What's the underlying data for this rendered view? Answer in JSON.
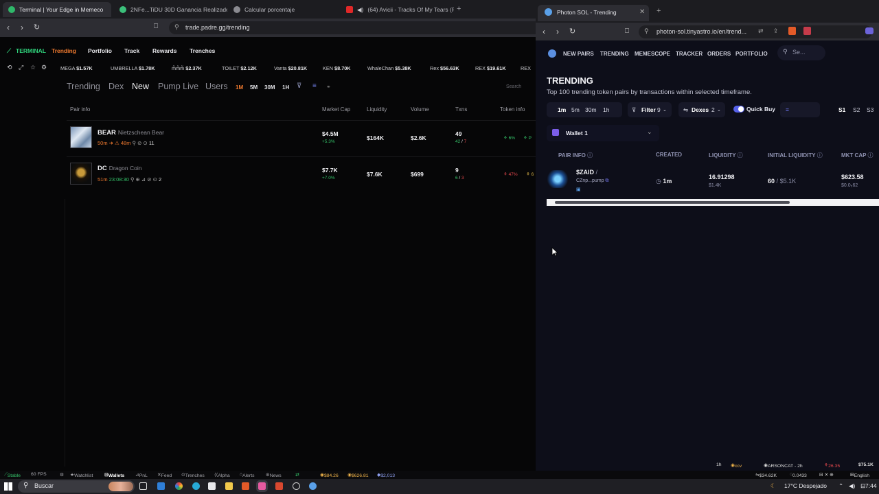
{
  "left_browser": {
    "tabs": [
      {
        "title": "Terminal | Your Edge in Memeco"
      },
      {
        "title": "2NFe...TiDU 30D Ganancia Realizado"
      },
      {
        "title": "Calcular porcentaje"
      },
      {
        "title": "(64) Avicii - Tracks Of My Tears (F"
      }
    ],
    "url": "trade.padre.gg/trending",
    "nav": {
      "logo": "TERMINAL",
      "items": [
        "Trending",
        "Portfolio",
        "Track",
        "Rewards",
        "Trenches"
      ]
    },
    "ticker": [
      {
        "name": "MEGA",
        "value": "$1.57K"
      },
      {
        "name": "UMBRELLA",
        "value": "$1.78K"
      },
      {
        "name": "m̃m̃m̃",
        "value": "$2.37K"
      },
      {
        "name": "TOILET",
        "value": "$2.12K"
      },
      {
        "name": "Vanta",
        "value": "$20.81K"
      },
      {
        "name": "KEN",
        "value": "$8.70K"
      },
      {
        "name": "WhaleChan",
        "value": "$5.38K"
      },
      {
        "name": "Rex",
        "value": "$56.63K"
      },
      {
        "name": "REX",
        "value": "$19.61K"
      },
      {
        "name": "REX",
        "value": ""
      }
    ],
    "subtabs": [
      "Trending",
      "Dex",
      "New",
      "Pump Live",
      "Users"
    ],
    "timeframes": [
      "1M",
      "5M",
      "30M",
      "1H"
    ],
    "search_placeholder": "Search",
    "columns": [
      "Pair info",
      "Market Cap",
      "Liquidity",
      "Volume",
      "Txns",
      "Token info"
    ],
    "rows": [
      {
        "ticker": "BEAR",
        "name": "Nietzschean Bear",
        "age": "50m",
        "meta": "48m",
        "holders": "11",
        "mcap": "$4.5M",
        "mcap_change": "+5.3%",
        "liquidity": "$164K",
        "volume": "$2.6K",
        "txns": "49",
        "buys": "42",
        "sells": "7",
        "info1": "6%",
        "info2": "P"
      },
      {
        "ticker": "DC",
        "name": "Dragon Coin",
        "age": "51m",
        "meta": "23:08:30",
        "holders": "2",
        "mcap": "$7.7K",
        "mcap_change": "+7.0%",
        "liquidity": "$7.6K",
        "volume": "$699",
        "txns": "9",
        "buys": "6",
        "sells": "3",
        "info1": "47%",
        "info2": "6"
      }
    ]
  },
  "status_bar": {
    "items": [
      "Stable",
      "60 FPS",
      "Watchlist",
      "Wallets",
      "PnL",
      "Feed",
      "Trenches",
      "Alpha",
      "Alerts",
      "News"
    ],
    "prices": [
      "$84.26",
      "$626.81",
      "$2,013"
    ],
    "right": [
      "1h",
      "ccv",
      "ARSONCAT - 2h",
      "26.35",
      "$75.1K",
      "$34.62K",
      "0.0433",
      "English"
    ]
  },
  "right_browser": {
    "tab_title": "Photon SOL - Trending",
    "url": "photon-sol.tinyastro.io/en/trend...",
    "nav": [
      "NEW PAIRS",
      "TRENDING",
      "MEMESCOPE",
      "TRACKER",
      "ORDERS",
      "PORTFOLIO"
    ],
    "search_placeholder": "Se...",
    "title": "TRENDING",
    "subtitle": "Top 100 trending token pairs by transactions within selected timeframe.",
    "timeframes": [
      "1m",
      "5m",
      "30m",
      "1h"
    ],
    "filter": {
      "label": "Filter",
      "count": "9"
    },
    "dexes": {
      "label": "Dexes",
      "count": "2"
    },
    "quick_buy": "Quick Buy",
    "quick_buy_value": "",
    "slots": [
      "S1",
      "S2",
      "S3"
    ],
    "wallet": "Wallet 1",
    "columns": [
      "PAIR INFO",
      "CREATED",
      "LIQUIDITY",
      "INITIAL LIQUIDITY",
      "MKT CAP"
    ],
    "row": {
      "ticker": "$ZAID",
      "slash": "/",
      "address": "CZnp...pump",
      "created": "1m",
      "liquidity": "16.91298",
      "liquidity_usd": "$1.4K",
      "initial": "60",
      "initial_usd": "$5.1K",
      "mkt_cap": "$623.58",
      "mkt_cap_sub": "$0.0₅62"
    }
  },
  "taskbar": {
    "search": "Buscar",
    "weather": "17°C  Despejado",
    "time": "7:44"
  }
}
